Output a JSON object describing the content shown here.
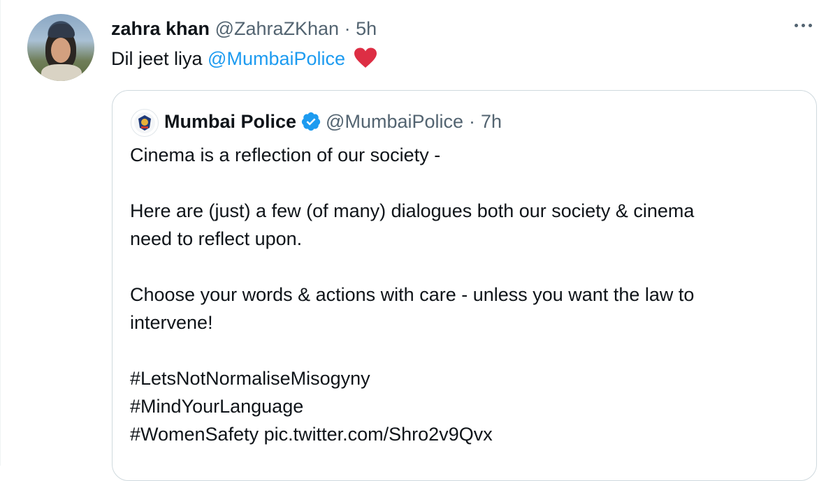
{
  "tweet": {
    "author_name": "zahra khan",
    "author_handle": "@ZahraZKhan",
    "separator": "·",
    "time": "5h",
    "text_before": "Dil jeet liya ",
    "mention": "@MumbaiPolice",
    "emoji": "red-heart",
    "more_icon": "ellipsis-icon"
  },
  "quoted": {
    "author_name": "Mumbai Police",
    "verified": true,
    "author_handle": "@MumbaiPolice",
    "separator": "·",
    "time": "7h",
    "lines": {
      "l1": "Cinema is a reflection of our society -",
      "l2": "Here are (just) a few (of many) dialogues both our society & cinema",
      "l3": "need to reflect upon.",
      "l4": "Choose your words & actions with care - unless you want the law to",
      "l5": "intervene!",
      "l6": "#LetsNotNormaliseMisogyny",
      "l7": "#MindYourLanguage",
      "l8": "#WomenSafety pic.twitter.com/Shro2v9Qvx"
    }
  },
  "colors": {
    "link": "#1d9bf0",
    "muted": "#536471",
    "border": "#cfd9de",
    "heart": "#e0245e"
  }
}
